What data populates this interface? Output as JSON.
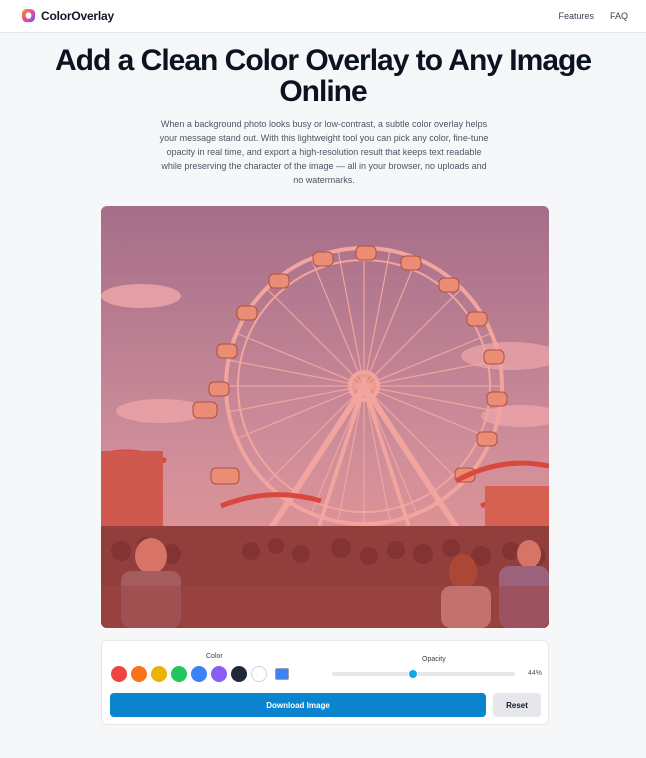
{
  "header": {
    "brand": "ColorOverlay",
    "nav": [
      "Features",
      "FAQ"
    ]
  },
  "hero": {
    "title": "Add a Clean Color Overlay to Any Image Online",
    "description": "When a background photo looks busy or low-contrast, a subtle color overlay helps your message stand out. With this lightweight tool you can pick any color, fine-tune opacity in real time, and export a high-resolution result that keeps text readable while preserving the character of the image — all in your browser, no uploads and no watermarks."
  },
  "preview": {
    "overlay_color": "#ef4444",
    "overlay_opacity": 0.44
  },
  "controls": {
    "color_label": "Color",
    "swatches": [
      "#ef4444",
      "#f97316",
      "#eab308",
      "#22c55e",
      "#3b82f6",
      "#8b5cf6",
      "#1f2937",
      "#ffffff"
    ],
    "custom_color": "#3b82f6",
    "opacity_label": "Opacity",
    "opacity_value": "44%",
    "opacity_fraction": 0.44,
    "download_label": "Download Image",
    "reset_label": "Reset"
  }
}
